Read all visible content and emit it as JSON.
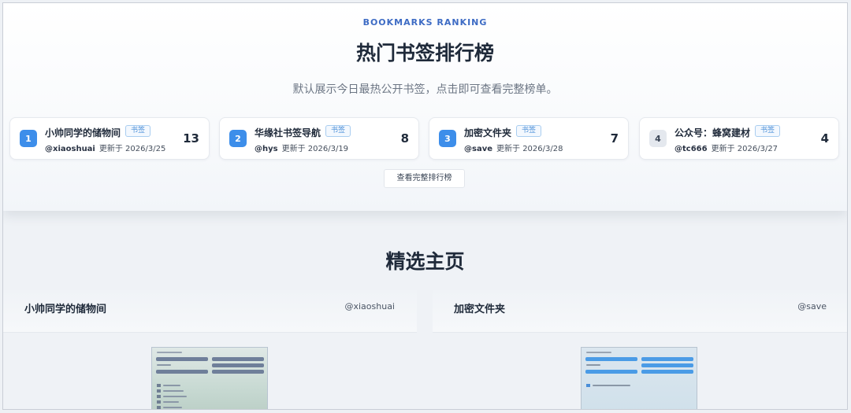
{
  "ranking": {
    "eyebrow": "BOOKMARKS RANKING",
    "title": "热门书签排行榜",
    "subtitle": "默认展示今日最热公开书签，点击即可查看完整榜单。",
    "view_all_label": "查看完整排行榜",
    "items": [
      {
        "rank": "1",
        "name": "小帅同学的储物间",
        "tag": "书签",
        "user": "@xiaoshuai",
        "updated": "更新于 2026/3/25",
        "count": "13"
      },
      {
        "rank": "2",
        "name": "华缘社书签导航",
        "tag": "书签",
        "user": "@hys",
        "updated": "更新于 2026/3/19",
        "count": "8"
      },
      {
        "rank": "3",
        "name": "加密文件夹",
        "tag": "书签",
        "user": "@save",
        "updated": "更新于 2026/3/28",
        "count": "7"
      },
      {
        "rank": "4",
        "name": "公众号：蜂窝建材",
        "tag": "书签",
        "user": "@tc666",
        "updated": "更新于 2026/3/27",
        "count": "4"
      }
    ]
  },
  "featured": {
    "title": "精选主页",
    "pages": [
      {
        "name": "小帅同学的储物间",
        "user": "@xiaoshuai",
        "preview_icon": "page-preview-thumbnail"
      },
      {
        "name": "加密文件夹",
        "user": "@save",
        "preview_icon": "page-preview-thumbnail"
      }
    ]
  },
  "colors": {
    "accent": "#3d8eea",
    "eyebrow": "#3d6bc4",
    "tag_border": "#a9cdf0"
  }
}
